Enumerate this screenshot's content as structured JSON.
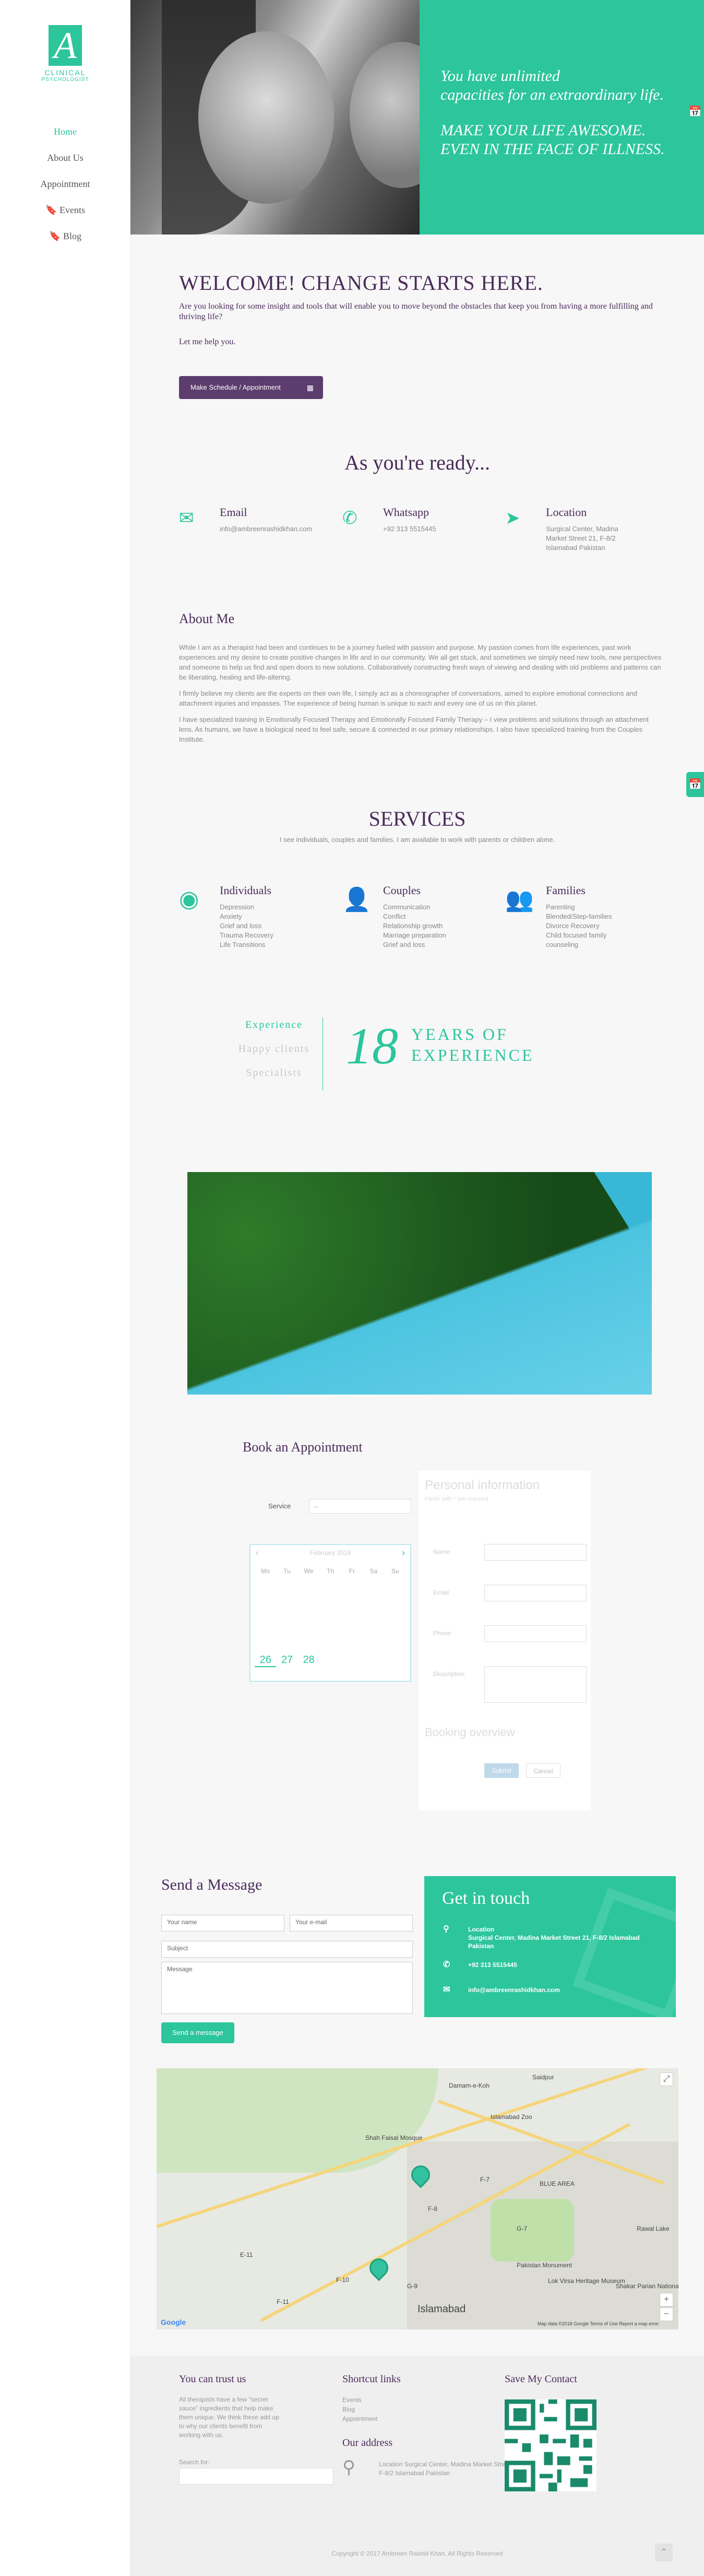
{
  "logo": {
    "letter": "A",
    "line1": "CLINICAL",
    "line2": "PSYCHOLOGIST"
  },
  "nav": [
    {
      "label": "Home",
      "icon": ""
    },
    {
      "label": "About Us",
      "icon": ""
    },
    {
      "label": "Appointment",
      "icon": ""
    },
    {
      "label": "Events",
      "icon": "🔖"
    },
    {
      "label": "Blog",
      "icon": "🔖"
    }
  ],
  "hero": {
    "line1a": "You have unlimited",
    "line1b": "capacities for an extraordinary life.",
    "line2a": "MAKE YOUR LIFE AWESOME.",
    "line2b": "EVEN IN THE FACE OF ILLNESS."
  },
  "welcome": {
    "title": "WELCOME! CHANGE STARTS HERE.",
    "para1": "Are you looking for some insight and tools that will enable you to move beyond the obstacles that keep you from having a more fulfilling and thriving life?",
    "para2": "Let me help you.",
    "button": "Make Schedule / Appointment"
  },
  "ready": {
    "title": "As you're ready...",
    "items": [
      {
        "icon": "email-icon",
        "title": "Email",
        "value": "info@ambreenrashidkhan.com"
      },
      {
        "icon": "phone-icon",
        "title": "Whatsapp",
        "value": "+92 313 5515445"
      },
      {
        "icon": "location-icon",
        "title": "Location",
        "value": "Surgical Center, Madina Market Street 21, F-8/2 Islamabad Pakistan"
      }
    ]
  },
  "about": {
    "title": "About Me",
    "paragraphs": [
      "While I am as a therapist had been and continues to be a journey fueled with passion and purpose. My passion comes from life experiences, past work experiences and my desire to create positive changes in life and in our community. We all get stuck, and sometimes we simply need new tools, new perspectives and someone to help us find and open doors to new solutions. Collaboratively constructing fresh ways of viewing and dealing with old problems and patterns can be liberating, healing and life-altering.",
      "I firmly believe my clients are the experts on their own life, I simply act as a choreographer of conversations, aimed to explore emotional connections and attachment injuries and impasses. The experience of being human is unique to each and every one of us on this planet.",
      "I have specialized training in Emotionally Focused Therapy and Emotionally Focused Family Therapy – I view problems and solutions through an attachment lens. As humans, we have a biological need to feel safe, secure & connected in our primary relationships. I also have specialized training from the Couples Institute."
    ]
  },
  "services": {
    "title": "SERVICES",
    "subtitle": "I see individuals, couples and families. I am available to work with parents or children alone.",
    "items": [
      {
        "icon": "individual-icon",
        "title": "Individuals",
        "list": [
          "Depression",
          "Anxiety",
          "Grief and loss",
          "Trauma Recovery",
          "Life Transitions"
        ]
      },
      {
        "icon": "couple-icon",
        "title": "Couples",
        "list": [
          "Communication",
          "Conflict",
          "Relationship growth",
          "Marriage preparation",
          "Grief and loss"
        ]
      },
      {
        "icon": "family-icon",
        "title": "Families",
        "list": [
          "Parenting",
          "Blended/Step-families",
          "Divorce Recovery",
          "Child focused family counseling"
        ]
      }
    ]
  },
  "experience": {
    "tabs": [
      "Experience",
      "Happy clients",
      "Specialists"
    ],
    "number": "18",
    "line1": "YEARS OF",
    "line2": "EXPERIENCE"
  },
  "booking": {
    "title": "Book an Appointment",
    "service_label": "Service",
    "service_value": "--",
    "calendar_month": "February 2018",
    "weekdays": [
      "Mo",
      "Tu",
      "We",
      "Th",
      "Fr",
      "Sa",
      "Su"
    ],
    "available_days": [
      "26",
      "27",
      "28"
    ],
    "personal_title": "Personal information",
    "note": "Fields with * are required",
    "fields": [
      "Name",
      "Email",
      "Phone",
      "Description"
    ],
    "overview_title": "Booking overview",
    "submit": "Submit",
    "cancel": "Cancel"
  },
  "message": {
    "title": "Send a Message",
    "name_ph": "Your name",
    "email_ph": "Your e-mail",
    "subject_ph": "Subject",
    "message_ph": "Message",
    "button": "Send a message"
  },
  "getintouch": {
    "title": "Get in touch",
    "location_label": "Location",
    "location_value": "Surgical Center, Madina Market Street 21, F-8/2 Islamabad Pakistan",
    "phone": "+92 313 5515445",
    "email": "info@ambreenrashidkhan.com"
  },
  "map": {
    "labels": [
      "Saidpur",
      "Damam-e-Koh",
      "Islamabad Zoo",
      "Shah Faisal Mosque",
      "F-7",
      "BLUE AREA",
      "F-8",
      "G-7",
      "E-11",
      "F-10",
      "G-9",
      "Pakistan Monument",
      "Lok Virsa Heritage Museum",
      "Shakar Parian National Park",
      "F-11",
      "Islamabad",
      "Rawal Lake"
    ],
    "attribution": "Map data ©2018 Google   Terms of Use   Report a map error",
    "google": "Google"
  },
  "footer": {
    "trust_title": "You can trust us",
    "trust_text": "All therapists have a few \"secret sauce\" ingredients that help make them unique. We think these add up to why our clients benefit from working with us.",
    "search_label": "Search for:",
    "shortcut_title": "Shortcut links",
    "shortcuts": [
      "Events",
      "Blog",
      "Appointment"
    ],
    "address_title": "Our address",
    "address_text": "Location Surgical Center, Madina Market Street 21, F-8/2 Islamabad Pakistan",
    "contact_title": "Save My Contact",
    "copyright": "Copyright © 2017 Ambreen Rashid Khan. All Rights Reserved"
  },
  "colors": {
    "accent": "#2cc59c",
    "purple": "#4a2b5a",
    "button_purple": "#5c3d6e"
  }
}
